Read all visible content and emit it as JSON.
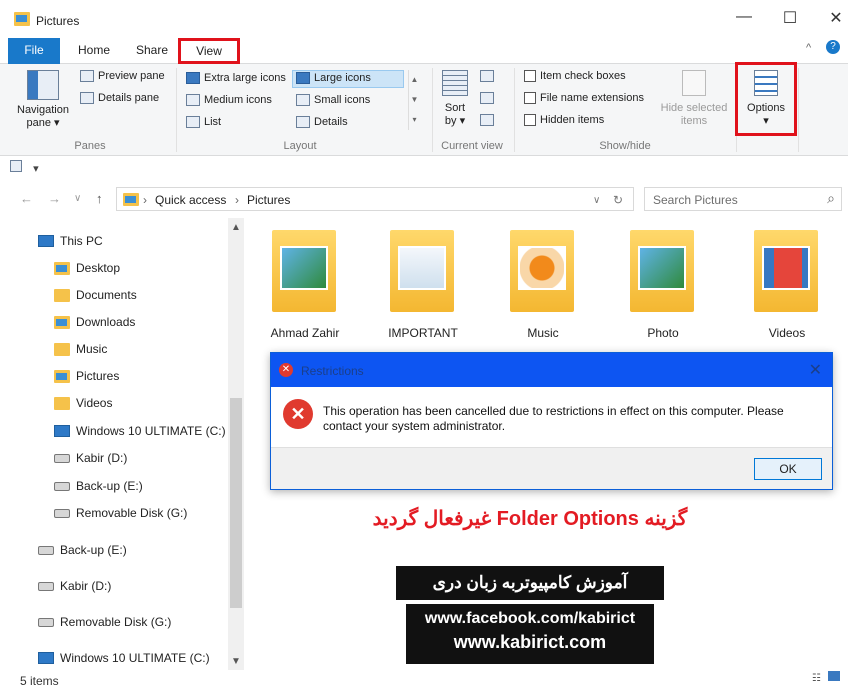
{
  "window": {
    "title": "Pictures",
    "min": "—",
    "max": "☐",
    "close": "✕"
  },
  "tabs": {
    "file": "File",
    "home": "Home",
    "share": "Share",
    "view": "View"
  },
  "ribbon": {
    "collapse": "^",
    "help": "?",
    "nav_pane_l1": "Navigation",
    "nav_pane_l2": "pane ▾",
    "preview_pane": "Preview pane",
    "details_pane": "Details pane",
    "panes_group": "Panes",
    "layout_items": [
      "Extra large icons",
      "Large icons",
      "Medium icons",
      "Small icons",
      "List",
      "Details"
    ],
    "layout_group": "Layout",
    "sort_l1": "Sort",
    "sort_l2": "by ▾",
    "current_view_group": "Current view",
    "item_check_boxes": "Item check boxes",
    "file_name_extensions": "File name extensions",
    "hidden_items": "Hidden items",
    "hide_selected_l1": "Hide selected",
    "hide_selected_l2": "items",
    "show_hide_group": "Show/hide",
    "options": "Options",
    "options_arrow": "▾"
  },
  "address": {
    "crumbs": [
      "Quick access",
      "Pictures"
    ],
    "search_placeholder": "Search Pictures"
  },
  "nav": {
    "items": [
      "This PC",
      "Desktop",
      "Documents",
      "Downloads",
      "Music",
      "Pictures",
      "Videos",
      "Windows 10 ULTIMATE (C:)",
      "Kabir (D:)",
      "Back-up (E:)",
      "Removable Disk (G:)",
      "Back-up (E:)",
      "Kabir (D:)",
      "Removable Disk (G:)",
      "Windows 10 ULTIMATE (C:)"
    ]
  },
  "folders": [
    "Ahmad Zahir",
    "IMPORTANT",
    "Music",
    "Photo",
    "Videos"
  ],
  "dialog": {
    "title": "Restrictions",
    "message": "This operation has been cancelled due to restrictions in effect on this computer. Please contact your system administrator.",
    "ok": "OK"
  },
  "overlay": {
    "headline": "گزینه Folder Options غیرفعال گردید",
    "banner": "آموزش کامپیوتربه زبان دری",
    "url1": "www.facebook.com/kabirict",
    "url2": "www.kabirict.com"
  },
  "status": {
    "items": "5 items"
  }
}
